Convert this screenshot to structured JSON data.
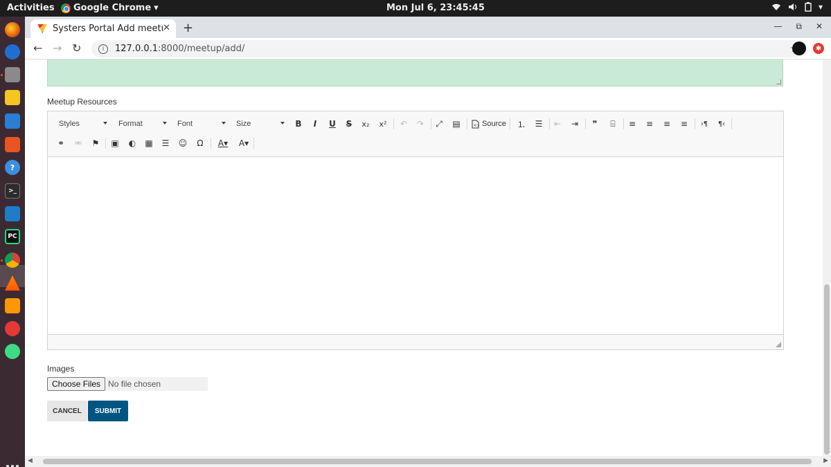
{
  "topbar": {
    "activities": "Activities",
    "app_name": "Google Chrome",
    "app_caret": "▾",
    "clock": "Mon Jul  6, 23:45:45",
    "wifi_icon": "wifi-icon",
    "volume_icon": "volume-icon",
    "battery_icon": "battery-icon",
    "menu_caret": "▾"
  },
  "dock": {
    "items": [
      "firefox-icon",
      "thunderbird-icon",
      "files-icon",
      "rhythmbox-icon",
      "libreoffice-writer-icon",
      "software-center-icon",
      "help-icon",
      "terminal-icon",
      "vscode-icon",
      "pycharm-icon",
      "chrome-icon",
      "vlc-icon",
      "sublime-text-icon",
      "youtube-music-icon",
      "android-studio-icon"
    ],
    "pycharm_label": "PC",
    "help_label": "?",
    "terminal_label": ">_"
  },
  "browser": {
    "tab_title": "Systers Portal Add meetup",
    "tab_close": "✕",
    "new_tab": "+",
    "back": "←",
    "forward": "→",
    "reload": "↻",
    "url_host": "127.0.0.1",
    "url_rest": ":8000/meetup/add/",
    "info_glyph": "i",
    "bookmark": "☆",
    "minimize": "—",
    "restore": "⧉",
    "close": "✕",
    "ext_badge": "✱"
  },
  "form": {
    "resources_label": "Meetup Resources",
    "images_label": "Images",
    "choose_files": "Choose Files",
    "no_file": "No file chosen",
    "cancel": "CANCEL",
    "submit": "SUBMIT"
  },
  "editor": {
    "combos": [
      "Styles",
      "Format",
      "Font",
      "Size"
    ],
    "source": "Source",
    "buttons_row1": {
      "bold": "B",
      "italic": "I",
      "underline": "U",
      "strike": "S",
      "subscript": "x₂",
      "superscript": "x²",
      "undo": "↶",
      "redo": "↷",
      "maximize": "⤢",
      "showblocks": "▤",
      "numbered_list": "⒈",
      "bulleted_list": "☰",
      "outdent": "⇤",
      "indent": "⇥",
      "blockquote": "❞",
      "div": "⌸",
      "align_left": "≡",
      "align_center": "≡",
      "align_right": "≡",
      "justify": "≡",
      "ltr": "›¶",
      "rtl": "¶‹"
    },
    "buttons_row2": {
      "link": "⚭",
      "unlink": "⚮",
      "anchor": "⚑",
      "image": "▣",
      "flash": "◐",
      "table": "▦",
      "hr": "☰",
      "smiley": "☺",
      "special_char": "Ω",
      "text_color": "A▾",
      "bg_color": "A▾"
    }
  },
  "scroll": {
    "left_arrow": "◀",
    "right_arrow": "▶"
  }
}
